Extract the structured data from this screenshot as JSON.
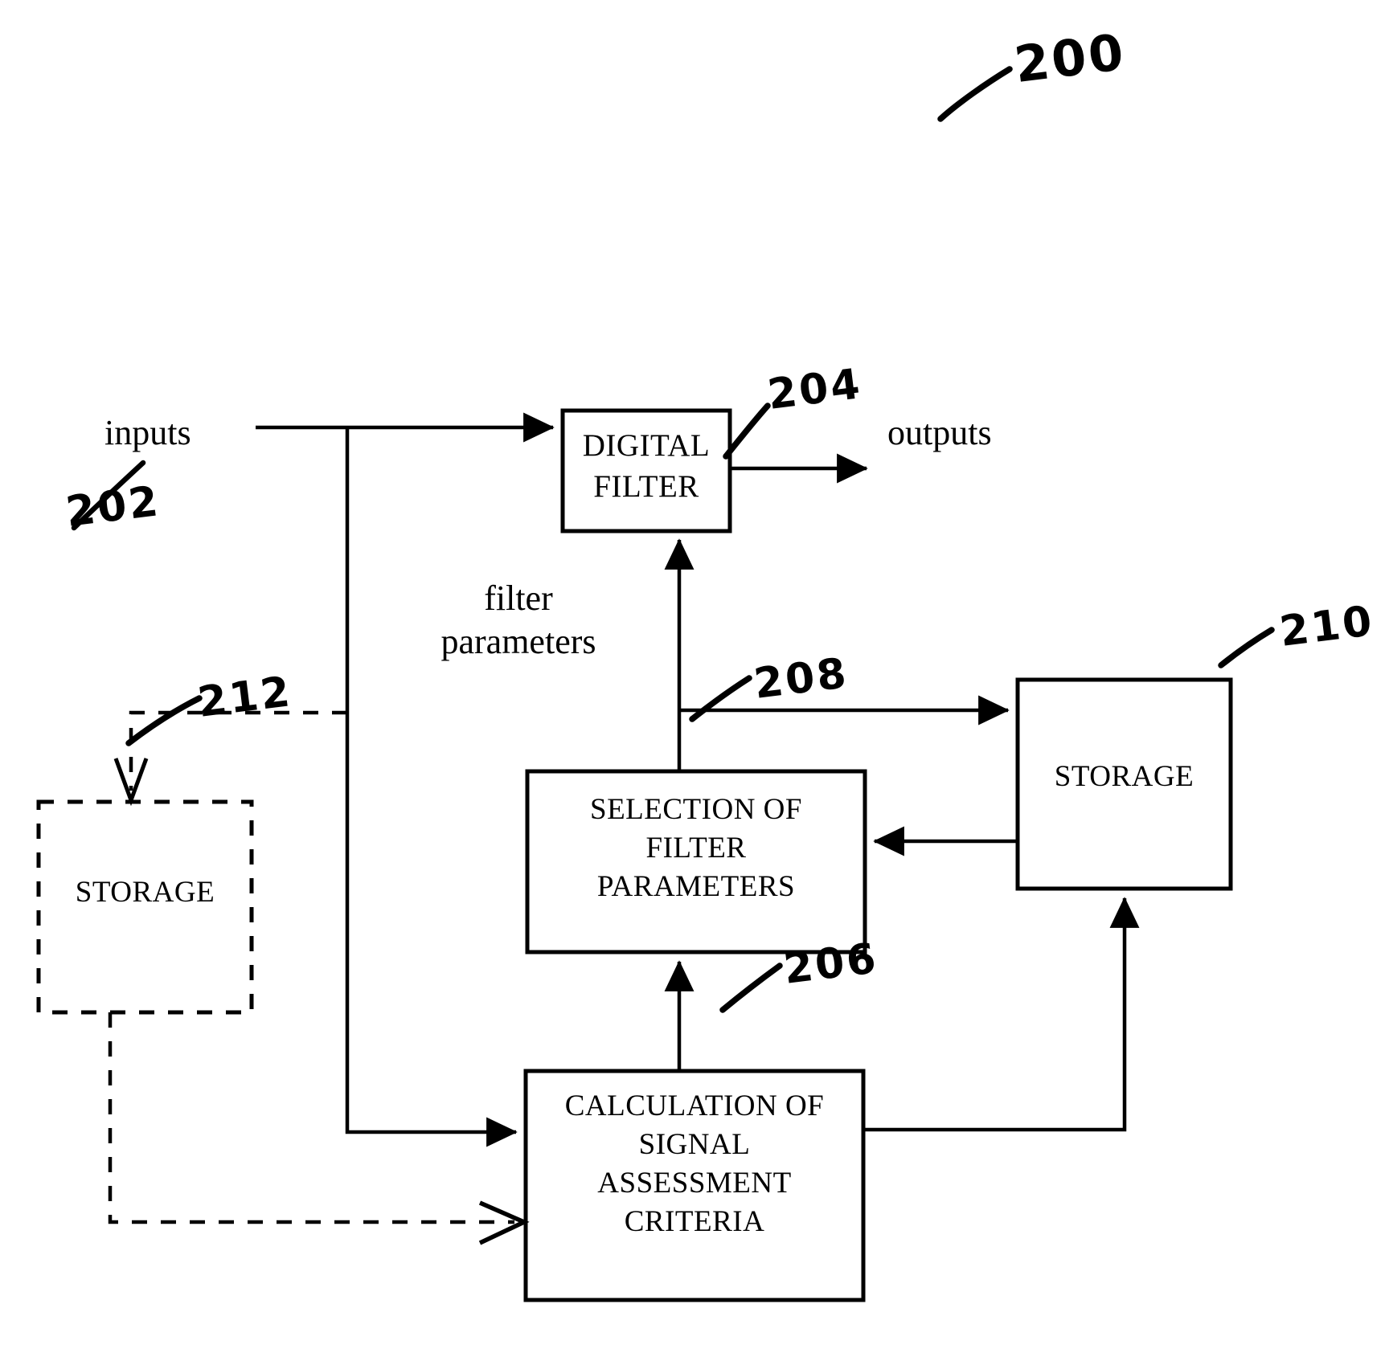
{
  "figure": {
    "figure_number": "200",
    "blocks": [
      {
        "id": "digital_filter",
        "label": "DIGITAL\nFILTER",
        "ref": "204",
        "style": "solid"
      },
      {
        "id": "storage_right",
        "label": "STORAGE",
        "ref": "210",
        "style": "solid"
      },
      {
        "id": "selection_of_filter_parameters",
        "label": "SELECTION OF\nFILTER\nPARAMETERS",
        "ref": "208",
        "style": "solid"
      },
      {
        "id": "calculation_of_signal_assessment_criteria",
        "label": "CALCULATION OF\nSIGNAL\nASSESSMENT\nCRITERIA",
        "ref": "206",
        "style": "solid"
      },
      {
        "id": "storage_left",
        "label": "STORAGE",
        "ref": "212",
        "style": "dashed"
      }
    ],
    "signals": [
      {
        "id": "inputs",
        "label": "inputs",
        "ref": "202"
      },
      {
        "id": "outputs",
        "label": "outputs",
        "ref": ""
      },
      {
        "id": "filter_parameters",
        "label": "filter\nparameters",
        "ref": ""
      }
    ],
    "colors": {
      "ink": "#000000",
      "paper": "#ffffff"
    }
  }
}
